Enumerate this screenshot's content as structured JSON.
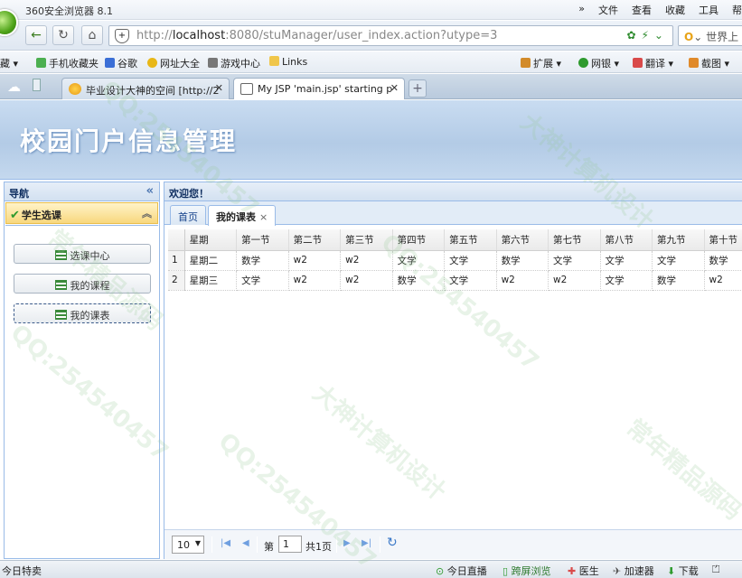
{
  "browser": {
    "title": "360安全浏览器 8.1",
    "menu": [
      "»",
      "文件",
      "查看",
      "收藏",
      "工具",
      "帮"
    ],
    "url_prefix": "http://",
    "url_host": "localhost",
    "url_rest": ":8080/stuManager/user_index.action?utype=3",
    "search_placeholder": "世界上",
    "favorites": [
      "藏",
      "手机收藏夹",
      "谷歌",
      "网址大全",
      "游戏中心",
      "Links"
    ],
    "toolbar_right": [
      "扩展",
      "网银",
      "翻译",
      "截图"
    ],
    "tabs": [
      {
        "label": "毕业设计大神的空间 [http://2",
        "active": false
      },
      {
        "label": "My JSP 'main.jsp' starting p",
        "active": true
      }
    ],
    "new_tab": "+"
  },
  "app": {
    "title": "校园门户信息管理",
    "nav": {
      "header": "导航",
      "section": "学生选课",
      "items": [
        {
          "label": "选课中心",
          "selected": false
        },
        {
          "label": "我的课程",
          "selected": false
        },
        {
          "label": "我的课表",
          "selected": true
        }
      ]
    },
    "welcome": "欢迎您！",
    "tabs": [
      {
        "label": "首页",
        "active": false
      },
      {
        "label": "我的课表",
        "active": true
      }
    ],
    "schedule": {
      "columns": [
        "星期",
        "第一节",
        "第二节",
        "第三节",
        "第四节",
        "第五节",
        "第六节",
        "第七节",
        "第八节",
        "第九节",
        "第十节"
      ],
      "rows": [
        {
          "n": "1",
          "cells": [
            "星期二",
            "数学",
            "w2",
            "w2",
            "文学",
            "文学",
            "数学",
            "文学",
            "文学",
            "文学",
            "数学"
          ]
        },
        {
          "n": "2",
          "cells": [
            "星期三",
            "文学",
            "w2",
            "w2",
            "数学",
            "文学",
            "w2",
            "w2",
            "文学",
            "数学",
            "w2"
          ]
        }
      ]
    },
    "pager": {
      "page_size": "10",
      "page_prefix": "第",
      "page_value": "1",
      "page_total": "共1页"
    }
  },
  "statusbar": {
    "left": "今日特卖",
    "items": [
      "今日直播",
      "跨屏浏览",
      "医生",
      "加速器",
      "下载",
      "⏍"
    ]
  },
  "watermark": [
    "QQ:254540457",
    "大神计算机设计",
    "常年精品源码"
  ]
}
